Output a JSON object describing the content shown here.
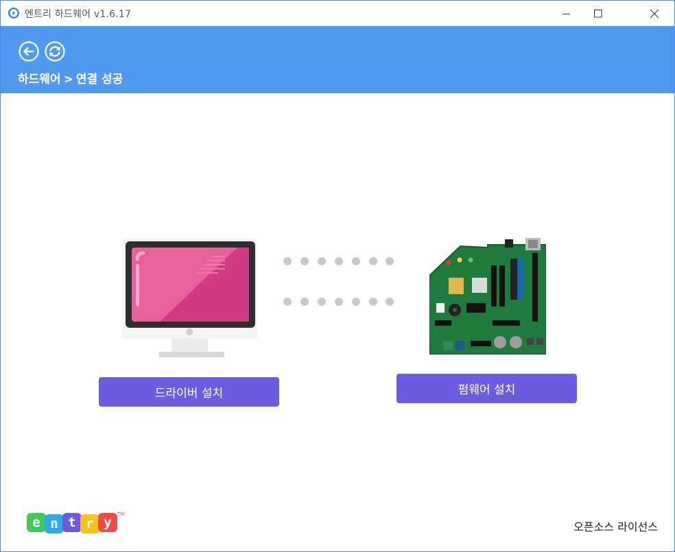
{
  "window": {
    "title": "엔트리 하드웨어 v1.6.17"
  },
  "header": {
    "breadcrumb_root": "하드웨어",
    "breadcrumb_sep": ">",
    "breadcrumb_current": "연결 성공"
  },
  "main": {
    "driver_button": "드라이버 설치",
    "firmware_button": "펌웨어 설치"
  },
  "footer": {
    "logo_letters": [
      "e",
      "n",
      "t",
      "r",
      "y"
    ],
    "logo_tm": "TM",
    "license_link": "오픈소스 라이선스"
  },
  "colors": {
    "header_bg": "#4f9af0",
    "button_bg": "#6c5de0",
    "logo": [
      "#3fca5c",
      "#2fa9e8",
      "#6c5de0",
      "#f7c31a",
      "#f04b4b"
    ]
  },
  "icons": [
    "app-icon",
    "minimize-icon",
    "maximize-icon",
    "close-icon",
    "back-icon",
    "refresh-icon",
    "monitor-icon",
    "board-image"
  ]
}
